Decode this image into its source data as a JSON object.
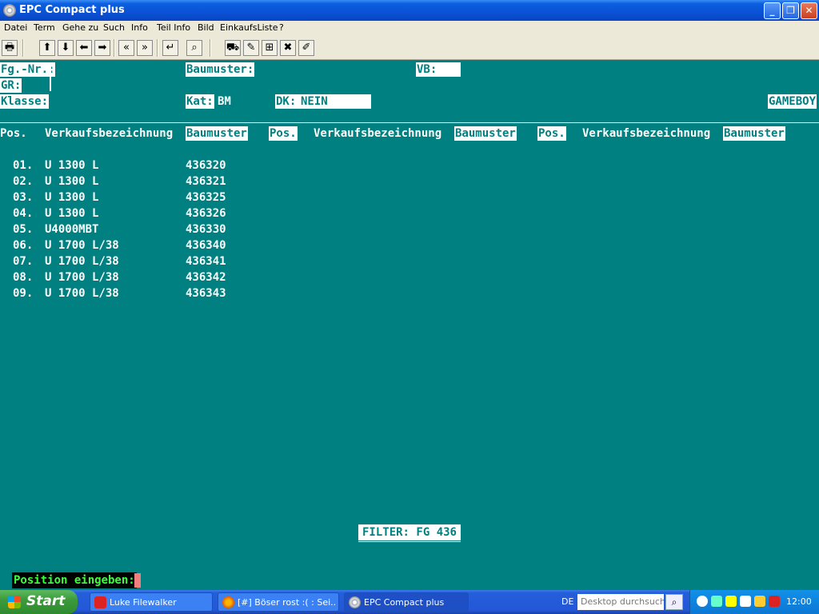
{
  "window": {
    "title": "EPC Compact plus"
  },
  "menu": [
    "Datei",
    "Term",
    "Gehe zu",
    "Such",
    "Info",
    "Teil Info",
    "Bild",
    "EinkaufsListe",
    "?"
  ],
  "form": {
    "fg_nr_label": "Fg.-Nr.:",
    "gr_label": "GR:",
    "klasse_label": "Klasse:",
    "baumuster_label": "Baumuster:",
    "vb_label": "VB:",
    "kat_label": "Kat:",
    "kat_value": "BM",
    "dk_label": "DK:",
    "dk_value": "NEIN",
    "gameboy": "GAMEBOY"
  },
  "table": {
    "headers": {
      "pos": "Pos.",
      "verkauf": "Verkaufsbezeichnung",
      "baumuster": "Baumuster"
    },
    "rows": [
      {
        "pos": "01.",
        "name": "U 1300 L",
        "bm": "436320"
      },
      {
        "pos": "02.",
        "name": "U 1300 L",
        "bm": "436321"
      },
      {
        "pos": "03.",
        "name": "U 1300 L",
        "bm": "436325"
      },
      {
        "pos": "04.",
        "name": "U 1300 L",
        "bm": "436326"
      },
      {
        "pos": "05.",
        "name": "U4000MBT",
        "bm": "436330"
      },
      {
        "pos": "06.",
        "name": "U 1700 L/38",
        "bm": "436340"
      },
      {
        "pos": "07.",
        "name": "U 1700 L/38",
        "bm": "436341"
      },
      {
        "pos": "08.",
        "name": "U 1700 L/38",
        "bm": "436342"
      },
      {
        "pos": "09.",
        "name": "U 1700 L/38",
        "bm": "436343"
      }
    ]
  },
  "filter": "FILTER: FG 436",
  "prompt": "Position eingeben:",
  "taskbar": {
    "start": "Start",
    "tasks": [
      "Luke Filewalker",
      "[#] Böser rost :( : Sei...",
      "EPC Compact plus"
    ],
    "lang": "DE",
    "search_placeholder": "Desktop durchsuchen",
    "clock": "12:00"
  },
  "colors": {
    "terminal_bg": "#008080",
    "prompt_fg": "#3cff3c",
    "cursor": "#f08080"
  }
}
